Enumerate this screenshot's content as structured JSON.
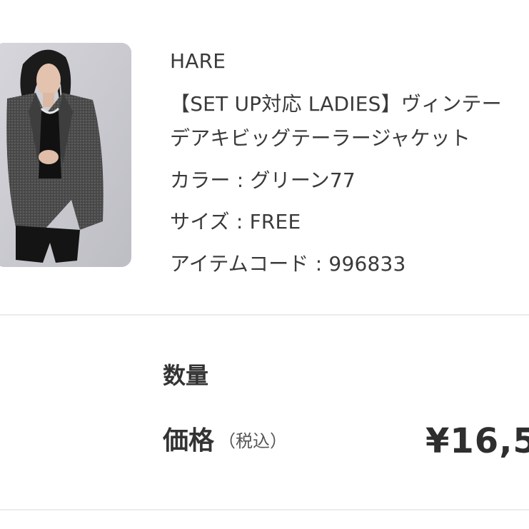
{
  "product": {
    "image_alt": "woman wearing grey tweed tailored jacket",
    "brand": "HARE",
    "title_line1": "【SET UP対応 LADIES】ヴィンテー",
    "title_line2": "デアキビッグテーラージャケット",
    "color": "カラー : グリーン77",
    "size": "サイズ : FREE",
    "item_code": "アイテムコード : 996833"
  },
  "order": {
    "quantity_label": "数量",
    "price_label": "価格",
    "tax_note": "（税込）",
    "price_value": "¥16,5"
  },
  "colors": {
    "text": "#3a3a3a",
    "divider": "#ececec",
    "image_bg": "#c9c9cf"
  }
}
